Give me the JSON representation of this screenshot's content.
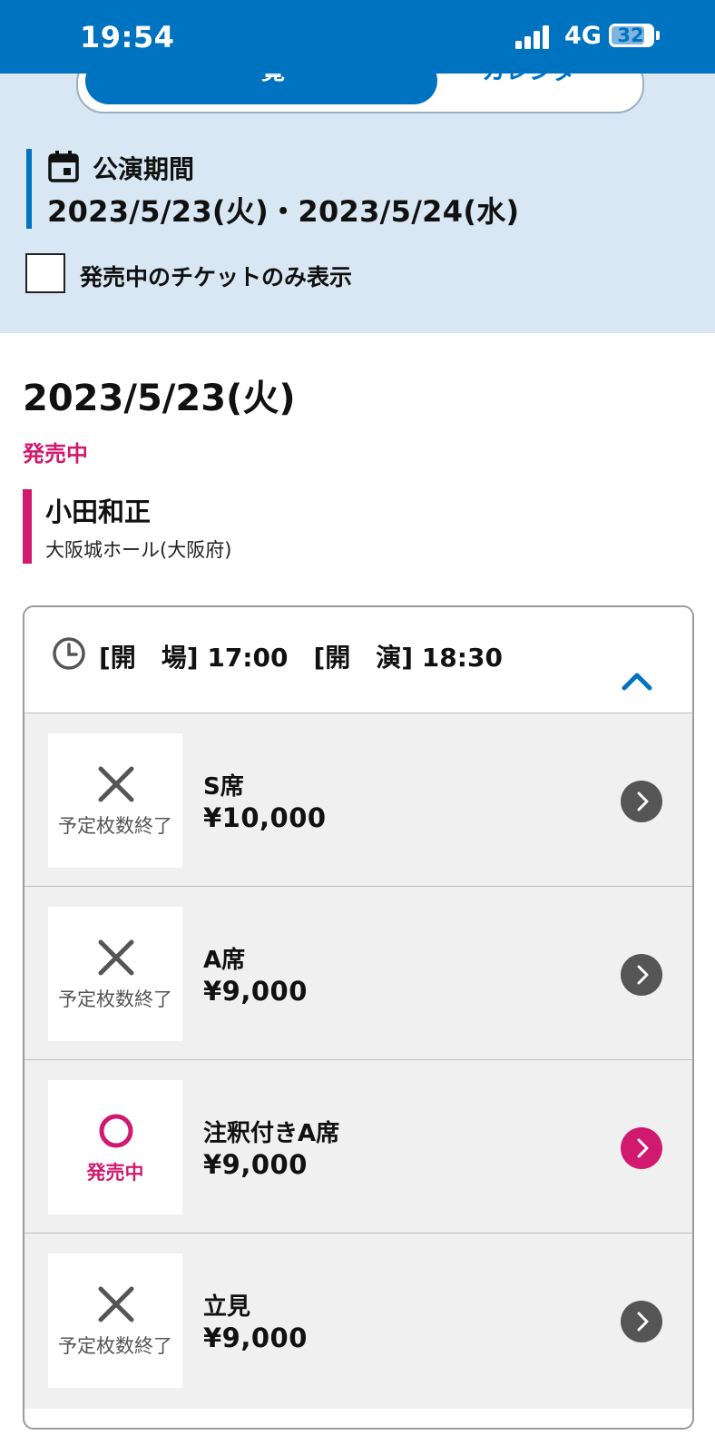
{
  "status_bar": {
    "time": "19:54",
    "network": "4G",
    "battery": "32",
    "icons": [
      "signal-icon",
      "battery-icon"
    ]
  },
  "view_toggle": {
    "list_label": "一覧",
    "calendar_label": "カレンダー",
    "selected": "list"
  },
  "period": {
    "label": "公演期間",
    "dates": "2023/5/23(火)・2023/5/24(水)",
    "icon": "calendar-icon"
  },
  "filter": {
    "checkbox_label": "発売中のチケットのみ表示",
    "checked": false
  },
  "day": {
    "title": "2023/5/23(火)",
    "sale_status": "発売中",
    "artist": "小田和正",
    "venue": "大阪城ホール(大阪府)"
  },
  "performance": {
    "time_text": "[開　場] 17:00　[開　演] 18:30",
    "seats": [
      {
        "name": "S席",
        "price": "¥10,000",
        "status": "予定枚数終了",
        "available": false
      },
      {
        "name": "A席",
        "price": "¥9,000",
        "status": "予定枚数終了",
        "available": false
      },
      {
        "name": "注釈付きA席",
        "price": "¥9,000",
        "status": "発売中",
        "available": true
      },
      {
        "name": "立見",
        "price": "¥9,000",
        "status": "予定枚数終了",
        "available": false
      }
    ]
  },
  "colors": {
    "brand_blue": "#0073c0",
    "accent_pink": "#d0196f",
    "filter_bg": "#d8e7f3",
    "row_bg": "#f0f0f0"
  }
}
